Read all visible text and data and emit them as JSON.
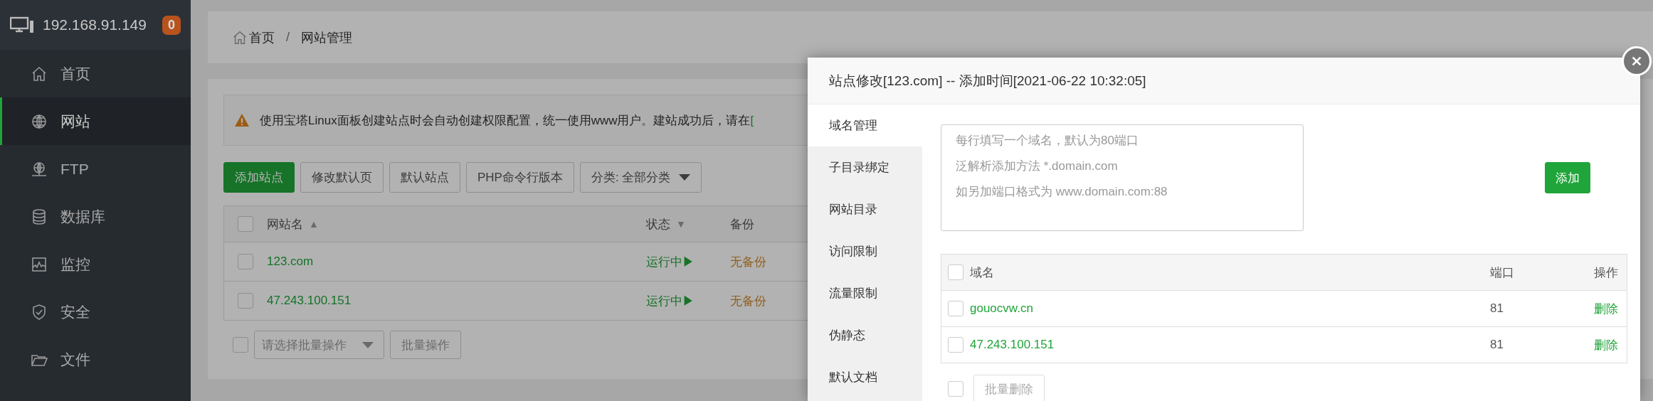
{
  "sidebar": {
    "host": "192.168.91.149",
    "badge": "0",
    "items": [
      {
        "label": "首页",
        "selected": false
      },
      {
        "label": "网站",
        "selected": true
      },
      {
        "label": "FTP",
        "selected": false
      },
      {
        "label": "数据库",
        "selected": false
      },
      {
        "label": "监控",
        "selected": false
      },
      {
        "label": "安全",
        "selected": false
      },
      {
        "label": "文件",
        "selected": false
      }
    ]
  },
  "breadcrumb": {
    "items": [
      "首页",
      "网站管理"
    ],
    "separator": "/"
  },
  "notice": {
    "text": "使用宝塔Linux面板创建站点时会自动创建权限配置，统一使用www用户。建站成功后，请在",
    "link": "["
  },
  "toolbar": [
    {
      "label": "添加站点",
      "kind": "primary"
    },
    {
      "label": "修改默认页",
      "kind": "default"
    },
    {
      "label": "默认站点",
      "kind": "default"
    },
    {
      "label": "PHP命令行版本",
      "kind": "default"
    },
    {
      "label": "分类: 全部分类",
      "kind": "dropdown"
    }
  ],
  "sites_table": {
    "checked": false,
    "columns": [
      {
        "label": "网站名",
        "sort_icon": "▲"
      },
      {
        "label": "状态",
        "sort_icon": "▼"
      },
      {
        "label": "备份"
      }
    ],
    "rows": [
      {
        "checked": false,
        "name": "123.com",
        "status": "运行中▶",
        "backup": "无备份"
      },
      {
        "checked": false,
        "name": "47.243.100.151",
        "status": "运行中▶",
        "backup": "无备份"
      }
    ]
  },
  "batch": {
    "checked": false,
    "placeholder": "请选择批量操作",
    "button": "批量操作"
  },
  "modal": {
    "title": "站点修改[123.com] -- 添加时间[2021-06-22 10:32:05]",
    "tabs": [
      {
        "label": "域名管理",
        "selected": true
      },
      {
        "label": "子目录绑定",
        "selected": false
      },
      {
        "label": "网站目录",
        "selected": false
      },
      {
        "label": "访问限制",
        "selected": false
      },
      {
        "label": "流量限制",
        "selected": false
      },
      {
        "label": "伪静态",
        "selected": false
      },
      {
        "label": "默认文档",
        "selected": false
      }
    ],
    "domain_input": {
      "placeholder_lines": [
        "每行填写一个域名，默认为80端口",
        "泛解析添加方法 *.domain.com",
        "如另加端口格式为 www.domain.com:88"
      ]
    },
    "add_button": "添加",
    "domain_table": {
      "checked": false,
      "columns": [
        "域名",
        "端口",
        "操作"
      ],
      "rows": [
        {
          "checked": false,
          "domain": "gouocvw.cn",
          "port": "81",
          "action": "删除"
        },
        {
          "checked": false,
          "domain": "47.243.100.151",
          "port": "81",
          "action": "删除"
        }
      ]
    },
    "batch_checked": false,
    "batch_delete": "批量删除"
  }
}
